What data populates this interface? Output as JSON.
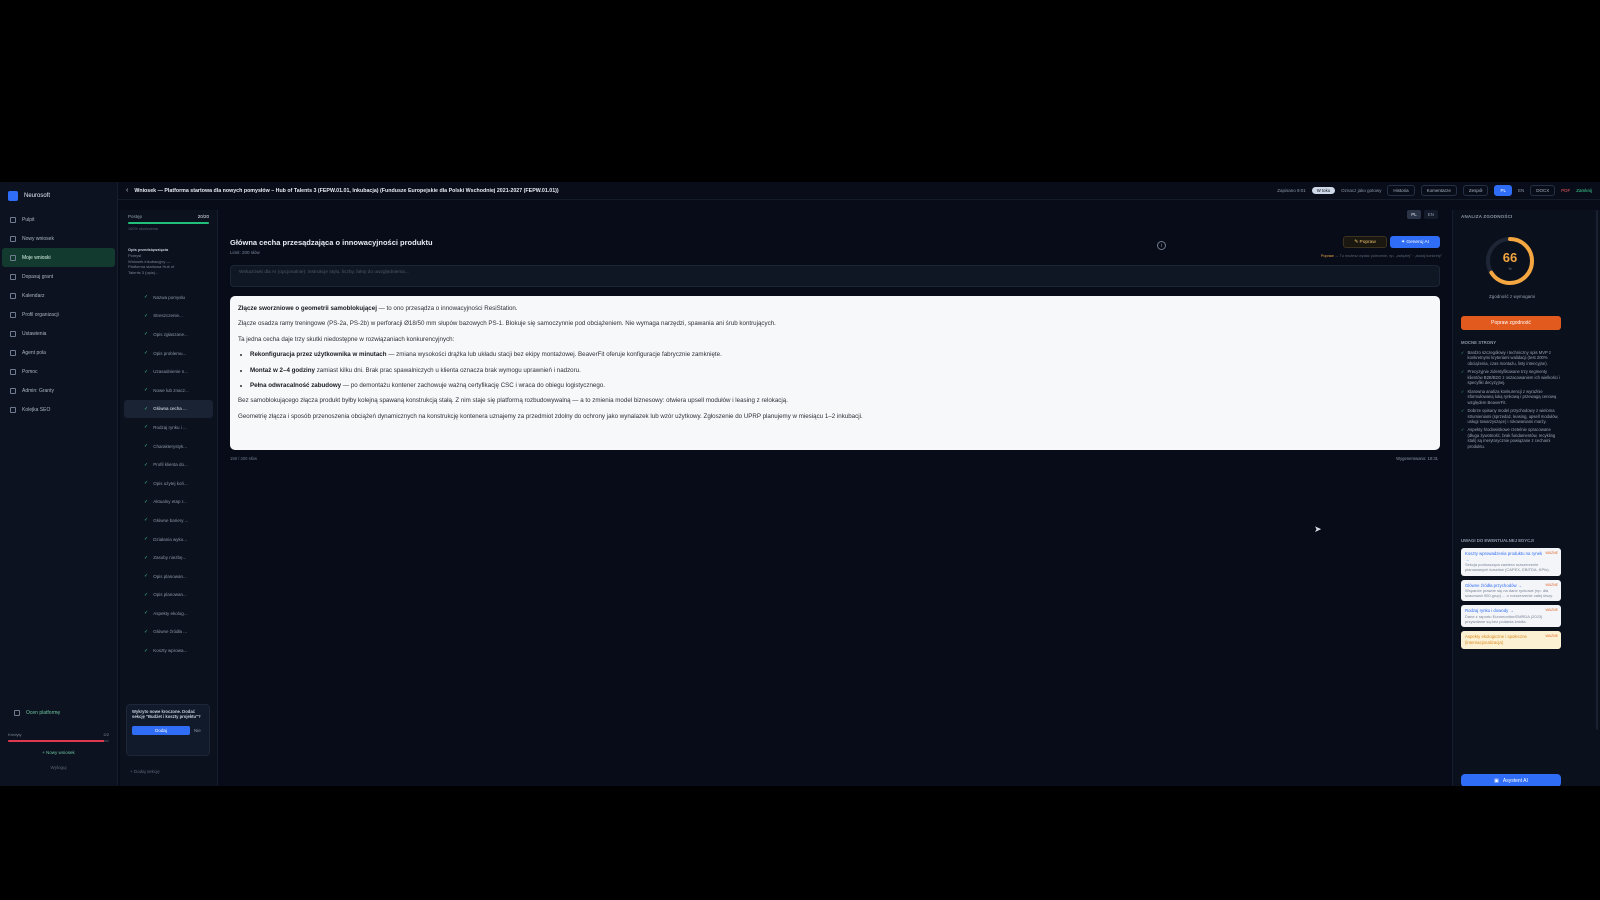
{
  "app": {
    "brand": "Neurosoft",
    "brand_color": "#2f6df6"
  },
  "nav": [
    {
      "icon": "dashboard-icon",
      "label": "Pulpit"
    },
    {
      "icon": "plus-icon",
      "label": "Nowy wniosek"
    },
    {
      "icon": "folder-icon",
      "label": "Moje wnioski",
      "active": true
    },
    {
      "icon": "search-icon",
      "label": "Dopasuj grant"
    },
    {
      "icon": "calendar-icon",
      "label": "Kalendarz"
    },
    {
      "icon": "building-icon",
      "label": "Profil organizacji"
    },
    {
      "icon": "settings-icon",
      "label": "Ustawienia"
    },
    {
      "icon": "agent-icon",
      "label": "Agent pola"
    },
    {
      "icon": "doc-icon",
      "label": "Pomoc"
    },
    {
      "icon": "grant-icon",
      "label": "Admin: Granty"
    },
    {
      "icon": "queue-icon",
      "label": "Kolejka SEO"
    }
  ],
  "sidebar_bottom": {
    "link": "Ocen platformę",
    "credits_label": "Kredyty",
    "credits_value": "2/2",
    "credits_fraction": 0.95,
    "new_button": "+ Nowy wniosek",
    "secondary": "Wyloguj"
  },
  "topbar": {
    "title": "Wniosek — Platforma startowa dla nowych pomysłów – Hub of Talents 3 (FEPW.01.01, Inkubacja) (Fundusze Europejskie dla Polski Wschodniej 2021-2027 (FEPW.01.01))",
    "autosave": "Zapisano 9:01",
    "mode_pill": "W toku",
    "mark_ready": "Oznacz jako gotowy",
    "history": "Historia",
    "comments": "Komentarze",
    "team": "Zespół",
    "lang_pl": "PL",
    "lang_en": "EN",
    "docx": "DOCX",
    "pdf": "PDF",
    "close": "Zamknij"
  },
  "sections_panel": {
    "progress_label": "Postęp",
    "progress_value": "20/20",
    "progress_sub": "100% ukończenia",
    "desc_title": "Opis przedsięwzięcia",
    "desc_lines": [
      "Pomysł",
      "Wniosek inkubacyjny —",
      "Platforma startowa Hub of",
      "Talents 3 (opis)..."
    ],
    "items": [
      "Nazwa pomysłu",
      "Streszczenie...",
      "Opis zgłaszane...",
      "Opis problemu...",
      "Uzasadnienie n...",
      "Nowe lub znacz...",
      "Główna cecha ...",
      "Rodzaj rynku i ...",
      "Charakterystyk...",
      "Profil klienta do...",
      "Opis użytej koń...",
      "Aktualny etap r...",
      "Główne bariery ...",
      "Działania wyko...",
      "Zasoby niezbę...",
      "Opis planowan...",
      "Opis planowan...",
      "Aspekty ekolog...",
      "Główne źródła ...",
      "Koszty wprowa..."
    ],
    "active_index": 6,
    "hint": "Wykryto nowe kroczone. Dodać sekcję \"Budżet i koszty projektu\"?",
    "hint_add": "Dodaj",
    "hint_no": "Nie",
    "add_section": "+ Dodaj sekcję"
  },
  "main": {
    "lang_pl": "PL",
    "lang_en": "EN",
    "section_title": "Główna cecha przesądzająca o innowacyjności produktu",
    "limit": "Limit: 200 słów",
    "btn_popraw": "✎ Popraw",
    "btn_generate": "✦ Generuj AI",
    "hint_prefix": "Popraw",
    "hint_text": " → Tu możesz wydać polecenie, np. „zwięźlej” · „dodaj konkrety”",
    "instruction_placeholder": "Wskazówki dla AI (opcjonalnie): instrukcje stylu, liczby, fakty do uwzględnienia...",
    "editor": {
      "p1_bold": "Złącze sworzniowe o geometrii samoblokującej",
      "p1_rest": " — to ono przesądza o innowacyjności ResiStation.",
      "p2": "Złącze osadza ramy treningowe (PS-2a, PS-2b) w perforacji Ø18/50 mm słupów bazowych PS-1. Blokuje się samoczynnie pod obciążeniem. Nie wymaga narzędzi, spawania ani śrub kontrujących.",
      "p3": "Ta jedna cecha daje trzy skutki niedostępne w rozwiązaniach konkurencyjnych:",
      "bullets": [
        {
          "b": "Rekonfiguracja przez użytkownika w minutach",
          "t": " — zmiana wysokości drążka lub układu stacji bez ekipy montażowej. BeaverFit oferuje konfiguracje fabrycznie zamknięte."
        },
        {
          "b": "Montaż w 2–4 godziny",
          "t": " zamiast kilku dni. Brak prac spawalniczych u klienta oznacza brak wymogu uprawnień i nadzoru."
        },
        {
          "b": "Pełna odwracalność zabudowy",
          "t": " — po demontażu kontener zachowuje ważną certyfikację CSC i wraca do obiegu logistycznego."
        }
      ],
      "p4": "Bez samoblokującego złącza produkt byłby kolejną spawaną konstrukcją stałą. Z nim staje się platformą rozbudowywalną — a to zmienia model biznesowy: otwiera upsell modułów i leasing z relokacją.",
      "p5": "Geometrię złącza i sposób przenoszenia obciążeń dynamicznych na konstrukcję kontenera uznajemy za przedmiot zdolny do ochrony jako wynalazek lub wzór użytkowy. Zgłoszenie do UPRP planujemy w miesiącu 1–2 inkubacji."
    },
    "word_counter": "158 / 200 słów",
    "saved": "Wygenerowano: 10:31"
  },
  "right_panel": {
    "heading": "ANALIZA ZGODNOŚCI",
    "score": 66,
    "score_sub": "%",
    "score_fraction": 0.66,
    "score_color": "#f4a640",
    "score_label": "Zgodność z wymogami",
    "improve_btn": "Popraw zgodność",
    "strengths_heading": "MOCNE STRONY",
    "strengths": [
      "Bardzo szczegółowy i techniczny opis MVP z konkretnymi kryteriami walidacji (test 200% obciążenia, czas montażu, listy intencyjne).",
      "Precyzyjnie zidentyfikowane trzy segmenty klientów B2B/B2G z oszacowaniem ich wielkości i specyfiki decyzyjnej.",
      "Klarowna analiza konkurencji z wyraźnie sformułowaną luką rynkową i przewagą cenową względem BeaverFit.",
      "Dobrze opisany model przychodowy z wieloma strumieniami (sprzedaż, leasing, upsell modułów, usługi towarzyszące) i rokowaniami marży.",
      "Aspekty środowiskowe rzetelnie opracowane (długa żywotność, brak fundamentów, recykling stali) są merytorycznie powiązane z cechami produktu."
    ],
    "notes_heading": "UWAGI DO EWENTUALNEJ EDYCJI",
    "notes": [
      {
        "title": "Koszty wprowadzenia produktu na rynek →",
        "desc": "Sekcja podnosząca zawiera rozszerzenie planowanych kosztów (CAPEX, EBITDA, KPIs).",
        "tag": "WAŻNE",
        "yellow": false
      },
      {
        "title": "Główne źródła przychodów →",
        "desc": "Wsparcie prawne się na dane rynkowe (np. dla szacowań 900 grup) ... o rozszerzenie całej niszy.",
        "tag": "WAŻNE",
        "yellow": false
      },
      {
        "title": "Rodzaj rynku i dowody →",
        "desc": "Dane z raportu Euromonitor/EMRDA (2023) przywołane są bez podania źródła.",
        "tag": "WAŻNE",
        "yellow": false
      },
      {
        "title": "Aspekty ekologiczne i społeczne (internacjonalizacja)",
        "desc": "",
        "tag": "WAŻNE",
        "yellow": true
      }
    ],
    "ai_btn": "Asystent AI"
  }
}
